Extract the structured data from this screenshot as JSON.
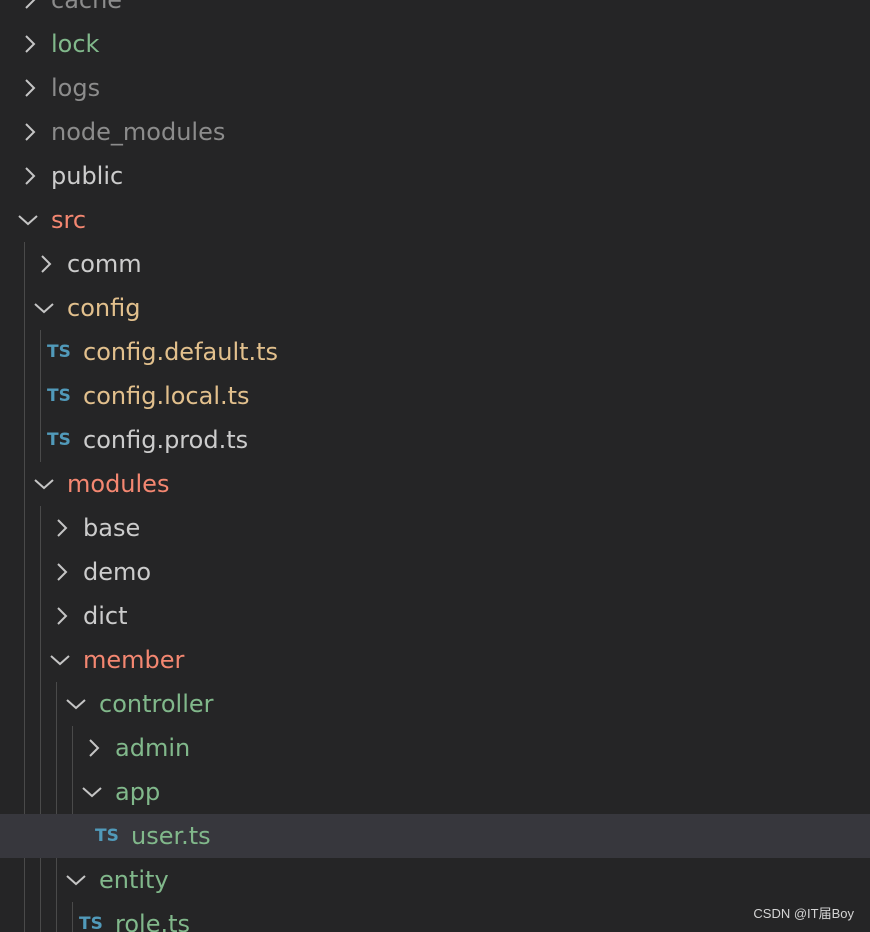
{
  "colors": {
    "background": "#252526",
    "selected_row": "#37373d",
    "default_text": "#cccccc",
    "untracked_green": "#81b88b",
    "ignored_grey": "#8c8c8c",
    "error_red": "#f48771",
    "modified_yellow": "#e2c08d",
    "ts_icon": "#519aba"
  },
  "tree": [
    {
      "name": "cache",
      "type": "folder",
      "expanded": false,
      "color": "#8c8c8c"
    },
    {
      "name": "lock",
      "type": "folder",
      "expanded": false,
      "color": "#81b88b"
    },
    {
      "name": "logs",
      "type": "folder",
      "expanded": false,
      "color": "#8c8c8c"
    },
    {
      "name": "node_modules",
      "type": "folder",
      "expanded": false,
      "color": "#8c8c8c"
    },
    {
      "name": "public",
      "type": "folder",
      "expanded": false,
      "color": "#cccccc"
    },
    {
      "name": "src",
      "type": "folder",
      "expanded": true,
      "color": "#f48771"
    },
    {
      "name": "comm",
      "type": "folder",
      "expanded": false,
      "color": "#cccccc"
    },
    {
      "name": "config",
      "type": "folder",
      "expanded": true,
      "color": "#e2c08d"
    },
    {
      "name": "config.default.ts",
      "type": "file",
      "icon": "TS",
      "color": "#e2c08d"
    },
    {
      "name": "config.local.ts",
      "type": "file",
      "icon": "TS",
      "color": "#e2c08d"
    },
    {
      "name": "config.prod.ts",
      "type": "file",
      "icon": "TS",
      "color": "#cccccc"
    },
    {
      "name": "modules",
      "type": "folder",
      "expanded": true,
      "color": "#f48771"
    },
    {
      "name": "base",
      "type": "folder",
      "expanded": false,
      "color": "#cccccc"
    },
    {
      "name": "demo",
      "type": "folder",
      "expanded": false,
      "color": "#cccccc"
    },
    {
      "name": "dict",
      "type": "folder",
      "expanded": false,
      "color": "#cccccc"
    },
    {
      "name": "member",
      "type": "folder",
      "expanded": true,
      "color": "#f48771"
    },
    {
      "name": "controller",
      "type": "folder",
      "expanded": true,
      "color": "#81b88b"
    },
    {
      "name": "admin",
      "type": "folder",
      "expanded": false,
      "color": "#81b88b"
    },
    {
      "name": "app",
      "type": "folder",
      "expanded": true,
      "color": "#81b88b"
    },
    {
      "name": "user.ts",
      "type": "file",
      "icon": "TS",
      "color": "#81b88b",
      "selected": true
    },
    {
      "name": "entity",
      "type": "folder",
      "expanded": true,
      "color": "#81b88b"
    },
    {
      "name": "role.ts",
      "type": "file",
      "icon": "TS",
      "color": "#81b88b"
    }
  ],
  "watermark": "CSDN @IT届Boy"
}
